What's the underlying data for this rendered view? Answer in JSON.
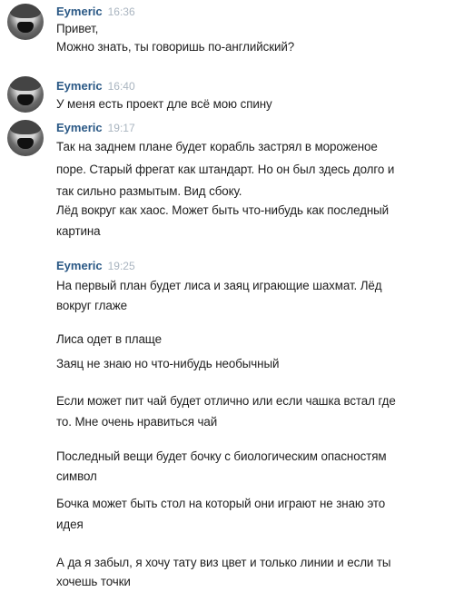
{
  "messages": [
    {
      "author": "Eymeric",
      "time": "16:36",
      "lines": [
        "Привет,",
        "Можно знать, ты говоришь по-английский?"
      ]
    },
    {
      "author": "Eymeric",
      "time": "16:40",
      "lines": [
        "У меня есть проект дле всё мою спину"
      ]
    },
    {
      "author": "Eymeric",
      "time": "19:17",
      "lines": [
        "Так на заднем плане будет корабль застрял в мороженое",
        "поре. Старый фрегат как штандарт. Но он был здесь долго и",
        "так сильно размытым. Вид сбоку.",
        "Лёд вокруг как хаос. Может быть что-нибудь как последный",
        "картина"
      ]
    },
    {
      "author": "Eymeric",
      "time": "19:25",
      "lines": [
        "На первый план будет лиса и заяц играющие шахмат. Лёд",
        "вокруг глаже"
      ]
    },
    {
      "lines": [
        "Лиса одет в плаще"
      ]
    },
    {
      "lines": [
        "Заяц не знаю но что-нибудь необычный"
      ]
    },
    {
      "lines": [
        "Если может пит чай будет отлично или если чашка встал где",
        "то. Мне очень нравиться чай"
      ]
    },
    {
      "lines": [
        "Последный вещи будет бочку с биологическим опасностям",
        "символ"
      ]
    },
    {
      "lines": [
        "Бочка может быть стол на который они играют не знаю это",
        "идея"
      ]
    },
    {
      "lines": [
        "А да я забыл, я хочу тату виз цвет и только линии и если ты",
        "хочешь точки"
      ]
    }
  ]
}
